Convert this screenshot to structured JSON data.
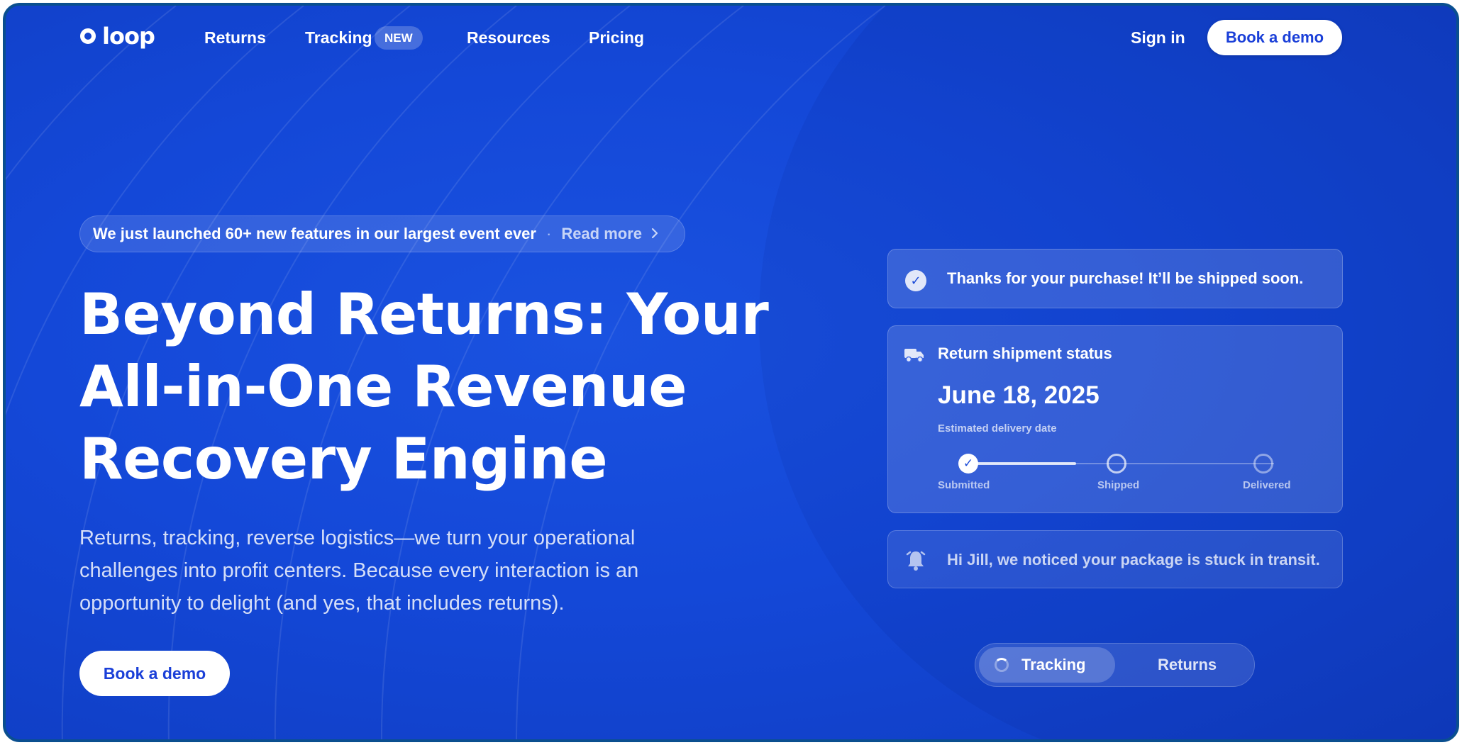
{
  "nav": {
    "logo_text": "loop",
    "links": [
      {
        "label": "Returns"
      },
      {
        "label": "Tracking",
        "badge": "NEW"
      },
      {
        "label": "Resources"
      },
      {
        "label": "Pricing"
      }
    ],
    "sign_in": "Sign in",
    "cta": "Book a demo"
  },
  "announcement": {
    "text": "We just launched 60+ new features in our largest event ever",
    "separator": "·",
    "link": "Read more",
    "icon": "chevron-right-icon"
  },
  "hero": {
    "title_lines": [
      "Beyond Returns: Your",
      "All-in-One Revenue",
      "Recovery Engine"
    ],
    "subtitle_lines": [
      "Returns, tracking, reverse logistics—we turn your operational",
      "challenges into profit centers. Because every interaction is an",
      "opportunity to delight (and yes, that includes returns)."
    ],
    "cta": "Book a demo"
  },
  "cards": {
    "purchase": {
      "icon": "check-circle-icon",
      "text": "Thanks for your purchase! It’ll be shipped soon."
    },
    "shipment": {
      "icon": "truck-icon",
      "title": "Return shipment status",
      "date": "June 18, 2025",
      "date_label": "Estimated delivery date",
      "steps": [
        {
          "label": "Submitted",
          "status": "done"
        },
        {
          "label": "Shipped",
          "status": "pending"
        },
        {
          "label": "Delivered",
          "status": "pending"
        }
      ],
      "progress": 0.35
    },
    "alert": {
      "icon": "bell-icon",
      "text": "Hi Jill, we noticed your package is stuck in transit."
    }
  },
  "toggle": {
    "options": [
      "Tracking",
      "Returns"
    ],
    "selected": "Tracking"
  },
  "colors": {
    "background": "#1448d8",
    "accent_text": "#1a3fd8",
    "frame_border": "#0a4f8f"
  }
}
